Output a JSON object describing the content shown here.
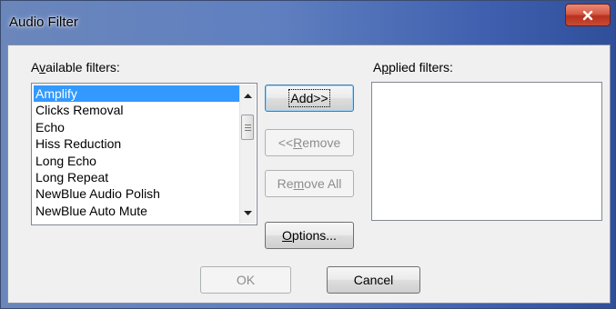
{
  "window": {
    "title": "Audio Filter"
  },
  "available": {
    "label_prefix": "A",
    "label_underlined": "v",
    "label_rest": "ailable filters:",
    "items": [
      "Amplify",
      "Clicks Removal",
      "Echo",
      "Hiss Reduction",
      "Long Echo",
      "Long Repeat",
      "NewBlue Audio Polish",
      "NewBlue Auto Mute"
    ],
    "selected": "Amplify"
  },
  "applied": {
    "label_prefix": "A",
    "label_underlined": "p",
    "label_rest": "plied filters:",
    "items": []
  },
  "buttons": {
    "add": "Add>>",
    "remove_prefix": "<<",
    "remove_underlined": "R",
    "remove_rest": "emove",
    "remove_all_prefix": "Re",
    "remove_all_underlined": "m",
    "remove_all_rest": "ove All",
    "options_underlined": "O",
    "options_rest": "ptions...",
    "ok": "OK",
    "cancel": "Cancel"
  },
  "icons": {
    "close": "close-x-icon",
    "scroll_up": "triangle-up-icon",
    "scroll_down": "triangle-down-icon"
  },
  "colors": {
    "selection": "#3399ff",
    "close_button": "#c84a33",
    "titlebar": "#5f7fc0"
  }
}
